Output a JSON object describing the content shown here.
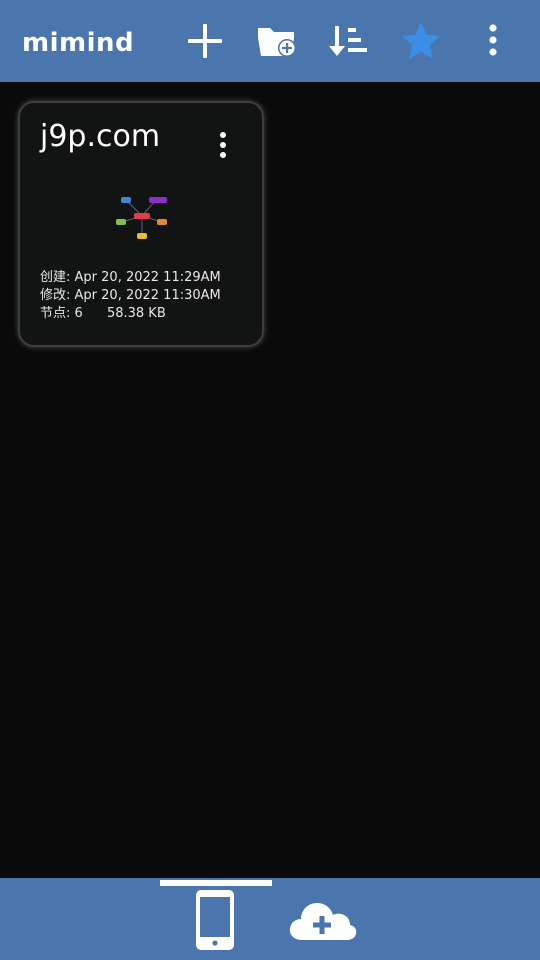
{
  "app": {
    "logo_text": "mimind"
  },
  "toolbar": {
    "icons": {
      "add": "plus-icon",
      "new_folder": "folder-add-icon",
      "sort": "sort-icon",
      "favorites": "star-icon",
      "more": "more-vertical-icon"
    },
    "colors": {
      "bar": "#4b76ad",
      "star": "#3a8ee8"
    }
  },
  "files": [
    {
      "title": "j9p.com",
      "created_label": "创建:",
      "created_value": "Apr 20, 2022 11:29AM",
      "modified_label": "修改:",
      "modified_value": "Apr 20, 2022 11:30AM",
      "nodes_label": "节点:",
      "nodes_value": "6",
      "size": "58.38 KB"
    }
  ],
  "bottom_nav": {
    "tabs": [
      {
        "icon": "phone-icon",
        "selected": true
      },
      {
        "icon": "cloud-add-icon",
        "selected": false
      }
    ]
  }
}
